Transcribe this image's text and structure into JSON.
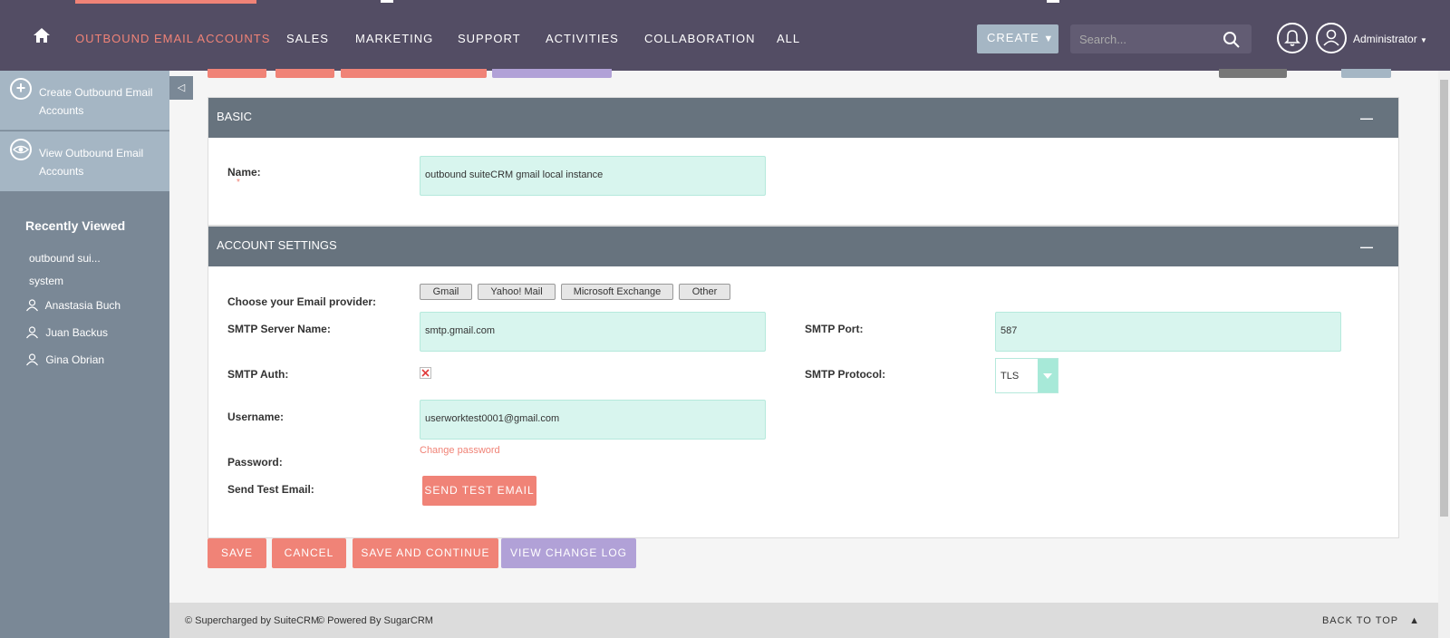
{
  "nav": {
    "items": [
      {
        "label": "OUTBOUND EMAIL ACCOUNTS",
        "active": true
      },
      {
        "label": "SALES"
      },
      {
        "label": "MARKETING"
      },
      {
        "label": "SUPPORT"
      },
      {
        "label": "ACTIVITIES"
      },
      {
        "label": "COLLABORATION"
      },
      {
        "label": "ALL"
      }
    ],
    "create_label": "CREATE",
    "search_placeholder": "Search...",
    "user": "Administrator"
  },
  "sidebar": {
    "actions": [
      {
        "label": "Create Outbound Email Accounts",
        "icon": "plus-icon"
      },
      {
        "label": "View Outbound Email Accounts",
        "icon": "eye-icon"
      }
    ],
    "recently_viewed_title": "Recently Viewed",
    "recent": [
      {
        "label": "outbound sui...",
        "icon": ""
      },
      {
        "label": "system",
        "icon": ""
      },
      {
        "label": "Anastasia Buch",
        "icon": "person-icon"
      },
      {
        "label": "Juan Backus",
        "icon": "person-icon"
      },
      {
        "label": "Gina Obrian",
        "icon": "person-icon"
      }
    ]
  },
  "basic": {
    "title": "BASIC",
    "name_label": "Name:",
    "name_value": "outbound suiteCRM gmail local instance"
  },
  "account_settings": {
    "title": "ACCOUNT SETTINGS",
    "provider_label": "Choose your Email provider:",
    "providers": [
      "Gmail",
      "Yahoo! Mail",
      "Microsoft Exchange",
      "Other"
    ],
    "smtp_server_label": "SMTP Server Name:",
    "smtp_server_value": "smtp.gmail.com",
    "smtp_port_label": "SMTP Port:",
    "smtp_port_value": "587",
    "smtp_auth_label": "SMTP Auth:",
    "smtp_auth_checked": true,
    "smtp_protocol_label": "SMTP Protocol:",
    "smtp_protocol_value": "TLS",
    "username_label": "Username:",
    "username_value": "userworktest0001@gmail.com",
    "password_label": "Password:",
    "change_password": "Change password",
    "send_test_label": "Send Test Email:",
    "send_test_button": "SEND TEST EMAIL"
  },
  "actions": {
    "save": "SAVE",
    "cancel": "CANCEL",
    "save_continue": "SAVE AND CONTINUE",
    "view_log": "VIEW CHANGE LOG"
  },
  "footer": {
    "supercharged": "© Supercharged by SuiteCRM",
    "powered": "© Powered By SugarCRM",
    "back_to_top": "BACK TO TOP"
  },
  "colors": {
    "nav_bg": "#534d64",
    "accent": "#f08377",
    "purple_btn": "#b1a1d7",
    "panel_header": "#67737e",
    "input_bg": "#d8f5ee"
  }
}
